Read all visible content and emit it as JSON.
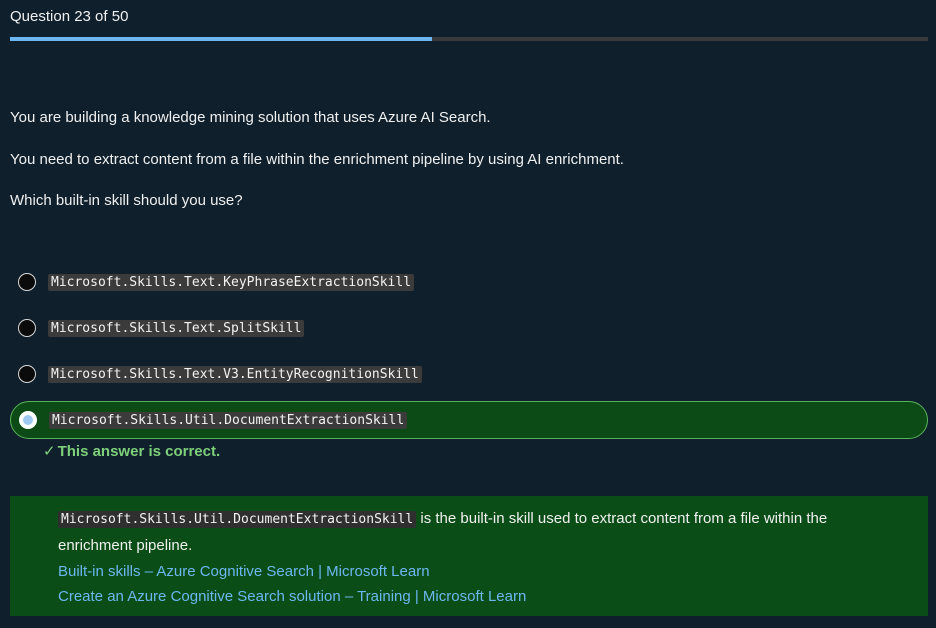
{
  "header": {
    "title": "Question 23 of 50",
    "progress_fraction": 0.46
  },
  "prompt": {
    "line1": "You are building a knowledge mining solution that uses Azure AI Search.",
    "line2": "You need to extract content from a file within the enrichment pipeline by using AI enrichment.",
    "line3": "Which built-in skill should you use?"
  },
  "options": [
    {
      "label": "Microsoft.Skills.Text.KeyPhraseExtractionSkill",
      "selected": false
    },
    {
      "label": "Microsoft.Skills.Text.SplitSkill",
      "selected": false
    },
    {
      "label": "Microsoft.Skills.Text.V3.EntityRecognitionSkill",
      "selected": false
    },
    {
      "label": "Microsoft.Skills.Util.DocumentExtractionSkill",
      "selected": true
    }
  ],
  "feedback": {
    "icon": "check-icon",
    "text": "This answer is correct.",
    "color": "#7ed07a"
  },
  "explanation": {
    "code": "Microsoft.Skills.Util.DocumentExtractionSkill",
    "text_after_code": " is the built-in skill used to extract content from a file within the",
    "text_line2": "enrichment pipeline.",
    "links": [
      "Built-in skills – Azure Cognitive Search | Microsoft Learn",
      "Create an Azure Cognitive Search solution – Training | Microsoft Learn"
    ]
  },
  "colors": {
    "background": "#0f1f2b",
    "accent": "#6cb6f2",
    "correct_green": "#0b4d16"
  }
}
